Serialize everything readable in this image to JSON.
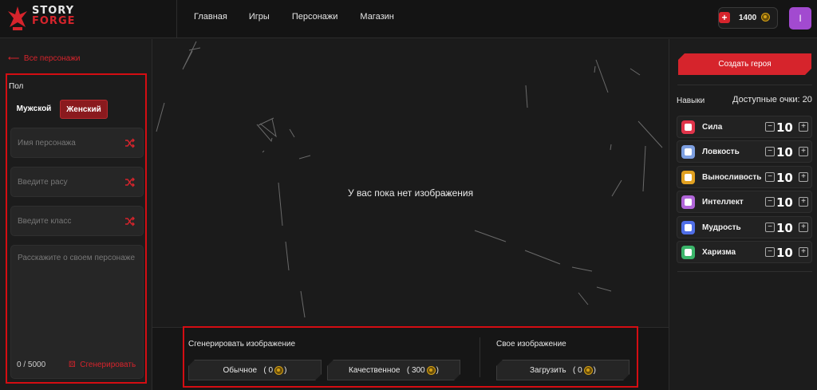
{
  "app": {
    "logo_line1": "STORY",
    "logo_line2": "FORGE"
  },
  "nav": {
    "items": [
      "Главная",
      "Игры",
      "Персонажи",
      "Магазин"
    ]
  },
  "header": {
    "balance": "1400",
    "avatar_letter": "I",
    "avatar_color": "#a24ad0"
  },
  "colors": {
    "accent": "#d6242c",
    "highlight_border": "#d40d12",
    "coin": "#d4a017"
  },
  "left": {
    "back_label": "Все персонажи",
    "gender_label": "Пол",
    "gender_options": [
      "Мужской",
      "Женский"
    ],
    "gender_selected": "Женский",
    "name_placeholder": "Имя персонажа",
    "race_placeholder": "Введите расу",
    "class_placeholder": "Введите класс",
    "story_placeholder": "Расскажите о своем персонаже",
    "counter": "0 / 5000",
    "generate_label": "Сгенерировать"
  },
  "center": {
    "empty_message": "У вас пока нет изображения"
  },
  "bottom": {
    "generate_title": "Сгенерировать изображение",
    "own_title": "Свое изображение",
    "regular_label": "Обычное",
    "regular_cost": "0",
    "quality_label": "Качественное",
    "quality_cost": "300",
    "upload_label": "Загрузить",
    "upload_cost": "0"
  },
  "right": {
    "create_label": "Создать героя",
    "skills_label": "Навыки",
    "points_label": "Доступные очки: 20",
    "skills": [
      {
        "name": "Сила",
        "value": "10",
        "color": "#e0344a",
        "icon": "fist-icon"
      },
      {
        "name": "Ловкость",
        "value": "10",
        "color": "#7d9fe0",
        "icon": "feather-icon"
      },
      {
        "name": "Выносливость",
        "value": "10",
        "color": "#e0a020",
        "icon": "flame-icon"
      },
      {
        "name": "Интеллект",
        "value": "10",
        "color": "#b065d8",
        "icon": "brain-icon"
      },
      {
        "name": "Мудрость",
        "value": "10",
        "color": "#4f6ee6",
        "icon": "book-icon"
      },
      {
        "name": "Харизма",
        "value": "10",
        "color": "#3bb56a",
        "icon": "speech-icon"
      }
    ]
  }
}
